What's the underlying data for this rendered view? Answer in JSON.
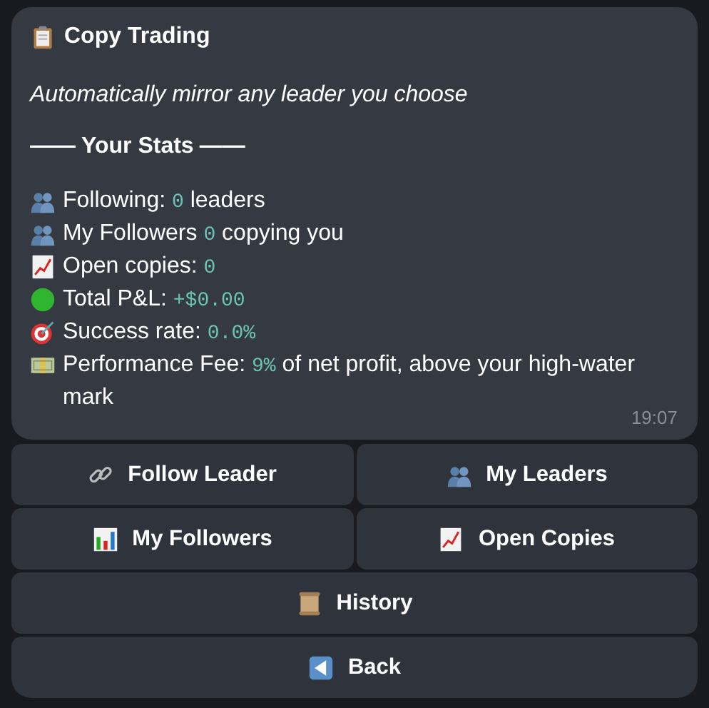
{
  "message": {
    "title": {
      "text": "Copy Trading",
      "kind": "clipboard"
    },
    "subtitle": "Automatically mirror any leader you choose",
    "section_heading": "Your Stats",
    "section_rule_left": "——",
    "section_rule_right": "——",
    "stats": [
      {
        "kind": "people",
        "label": "Following:",
        "value": "0",
        "suffix": "leaders"
      },
      {
        "kind": "people",
        "label": "My Followers",
        "value": "0",
        "suffix": "copying you"
      },
      {
        "kind": "chart-up",
        "label": "Open copies:",
        "value": "0"
      },
      {
        "kind": "green-circle",
        "label": "Total P&L:",
        "value": "+$0.00"
      },
      {
        "kind": "target",
        "label": "Success rate:",
        "value": "0.0%"
      },
      {
        "kind": "money",
        "label": "Performance Fee:",
        "value": "9%",
        "suffix": "of net profit, above your high-water mark"
      }
    ],
    "time": "19:07"
  },
  "keyboard": [
    [
      {
        "label": "Follow Leader",
        "kind": "link"
      },
      {
        "label": "My Leaders",
        "kind": "people"
      }
    ],
    [
      {
        "label": "My Followers",
        "kind": "bar-chart"
      },
      {
        "label": "Open Copies",
        "kind": "chart-up"
      }
    ],
    [
      {
        "label": "History",
        "kind": "scroll"
      }
    ],
    [
      {
        "label": "Back",
        "kind": "back"
      }
    ]
  ]
}
